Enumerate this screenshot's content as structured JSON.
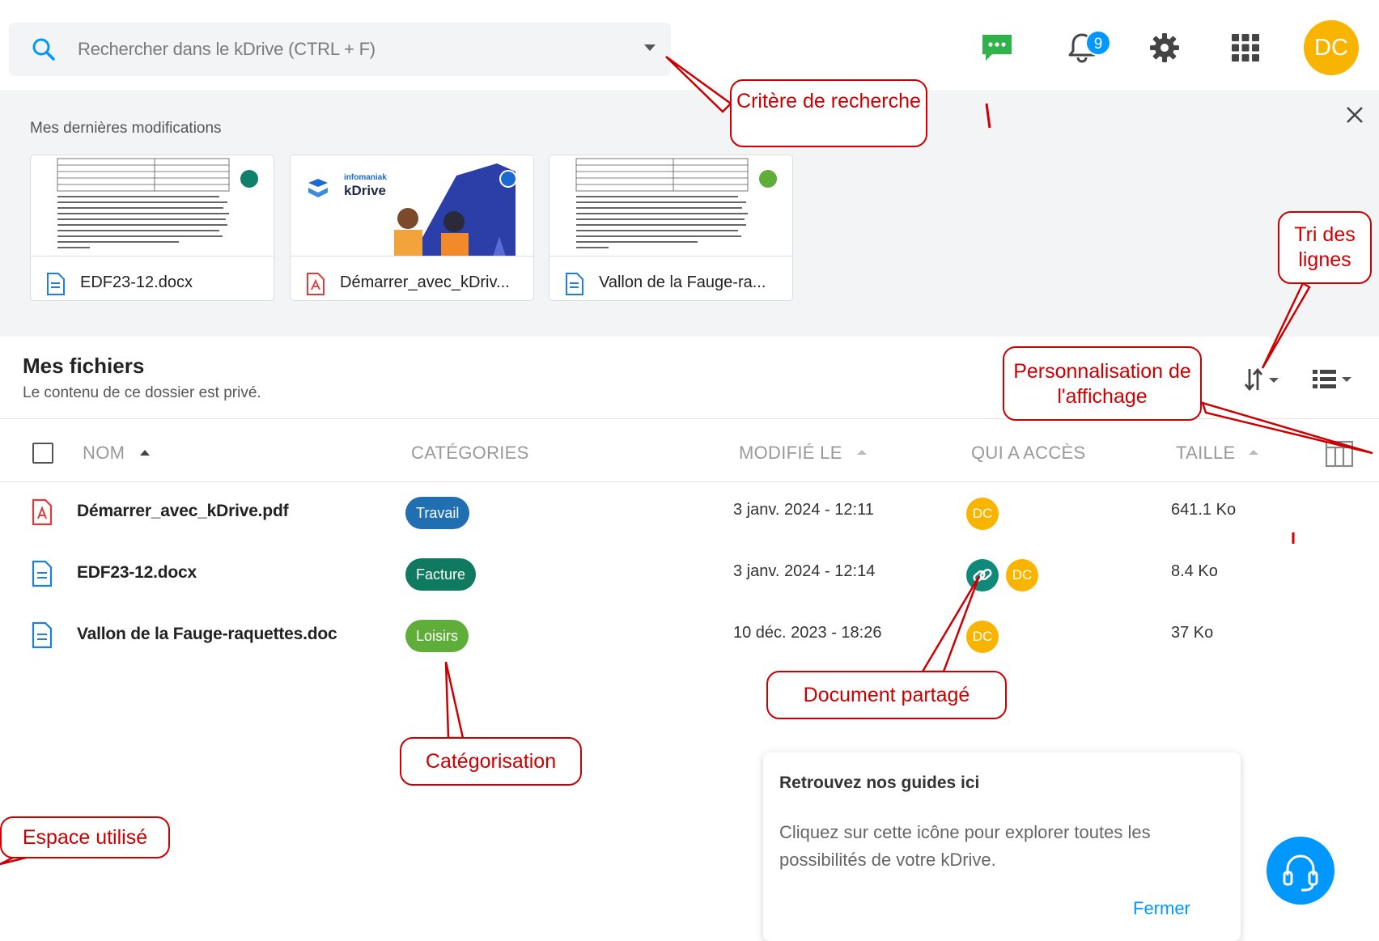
{
  "search": {
    "placeholder": "Rechercher dans le kDrive (CTRL + F)"
  },
  "header": {
    "notifications_count": "9",
    "user_initials": "DC"
  },
  "recent": {
    "title": "Mes dernières modifications",
    "cards": [
      {
        "name": "EDF23-12.docx",
        "thumb_brand": "",
        "thumb_title": ""
      },
      {
        "name": "Démarrer_avec_kDriv...",
        "thumb_brand": "infomaniak",
        "thumb_title": "kDrive"
      },
      {
        "name": "Vallon de la Fauge-ra..."
      }
    ]
  },
  "files": {
    "title": "Mes fichiers",
    "subtitle": "Le contenu de ce dossier est privé.",
    "columns": {
      "name": "NOM",
      "categories": "CATÉGORIES",
      "modified": "MODIFIÉ LE",
      "access": "QUI A ACCÈS",
      "size": "TAILLE"
    },
    "rows": [
      {
        "name": "Démarrer_avec_kDrive.pdf",
        "tag": "Travail",
        "date": "3 janv. 2024 - 12:11",
        "access": "DC",
        "size": "641.1 Ko"
      },
      {
        "name": "EDF23-12.docx",
        "tag": "Facture",
        "date": "3 janv. 2024 - 12:14",
        "access": "DC",
        "size": "8.4 Ko"
      },
      {
        "name": "Vallon de la Fauge-raquettes.doc",
        "tag": "Loisirs",
        "date": "10 déc. 2023 - 18:26",
        "access": "DC",
        "size": "37 Ko"
      }
    ]
  },
  "guide": {
    "title": "Retrouvez nos guides ici",
    "text": "Cliquez sur cette icône pour explorer toutes les possibilités de votre kDrive.",
    "close_label": "Fermer"
  },
  "annotations": {
    "search_criteria": "Critère de recherche",
    "sort_lines": "Tri des lignes",
    "display_custom": "Personnalisation de l'affichage",
    "shared_doc": "Document partagé",
    "categorisation": "Catégorisation",
    "used_space": "Espace utilisé"
  },
  "colors": {
    "accent": "#0098ff",
    "avatar": "#f9b400",
    "tag_travail": "#1f6fb2",
    "tag_facture": "#0f7a5f",
    "tag_loisirs": "#5fae3a",
    "annotation": "#cc0000"
  }
}
